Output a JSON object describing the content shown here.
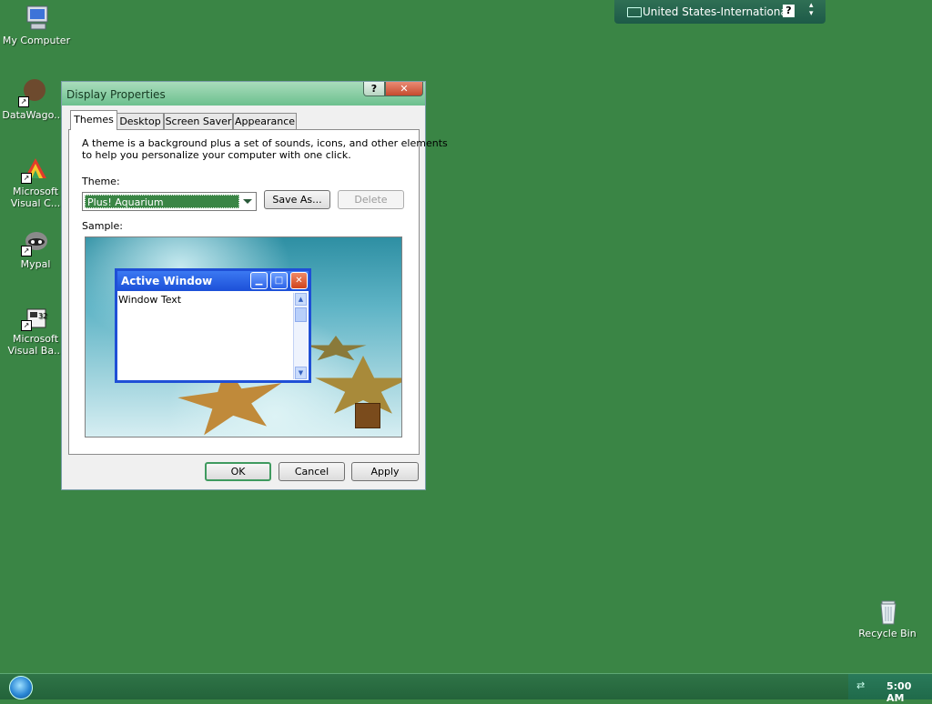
{
  "desktop": {
    "icons": [
      {
        "label": "My Computer",
        "icon": "computer-icon"
      },
      {
        "label": "DataWago...",
        "icon": "datawago-icon"
      },
      {
        "label_lines": [
          "Microsoft",
          "Visual C..."
        ],
        "icon": "visual-c-icon"
      },
      {
        "label": "Mypal",
        "icon": "mypal-icon"
      },
      {
        "label_lines": [
          "Microsoft",
          "Visual Ba..."
        ],
        "icon": "visual-basic-icon"
      },
      {
        "label": "Recycle Bin",
        "icon": "recycle-bin-icon"
      }
    ]
  },
  "language_bar": {
    "language": "United States-International",
    "help_label": "?",
    "icon": "keyboard-icon"
  },
  "dialog": {
    "title": "Display Properties",
    "help_button": "?",
    "close_button": "✕",
    "tabs": [
      "Themes",
      "Desktop",
      "Screen Saver",
      "Appearance"
    ],
    "active_tab": "Themes",
    "description_lines": [
      "A theme is a background plus a set of sounds, icons, and other elements",
      "to help you personalize your computer with one click."
    ],
    "theme_label": "Theme:",
    "theme_value": "Plus! Aquarium",
    "save_as": "Save As...",
    "delete": "Delete",
    "sample_label": "Sample:",
    "preview": {
      "window_title": "Active Window",
      "window_text": "Window Text"
    },
    "buttons": {
      "ok": "OK",
      "cancel": "Cancel",
      "apply": "Apply"
    }
  },
  "taskbar": {
    "clock": "5:00 AM",
    "start_icon": "windows-orb-icon",
    "tray_icon": "network-icon"
  },
  "colors": {
    "desktop": "#3a8545",
    "titlebar": "#6cc08e",
    "preview_titlebar": "#1c4fd8",
    "taskbar": "#23633a"
  }
}
